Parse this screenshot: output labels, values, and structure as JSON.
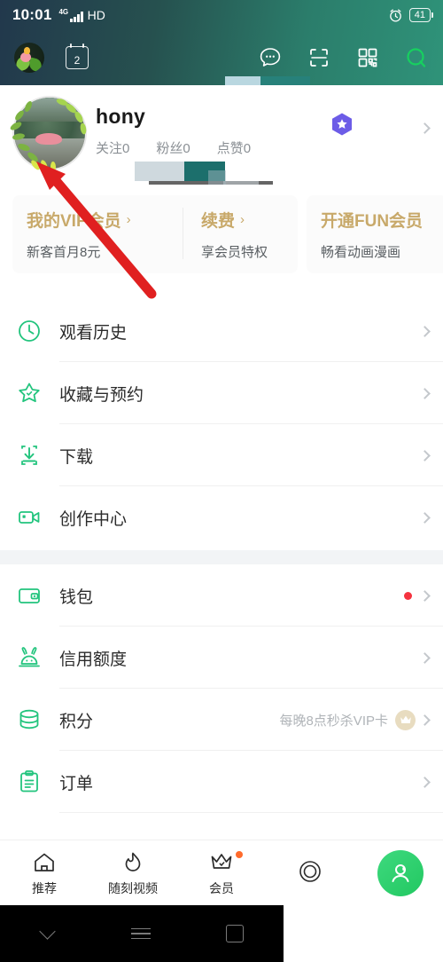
{
  "status_bar": {
    "time": "10:01",
    "network": "4G",
    "hd": "HD",
    "battery": "41",
    "alarm_icon": "alarm-clock-icon"
  },
  "app_bar": {
    "avatar_icon": "user-avatar-icon",
    "calendar_day": "2",
    "icons": [
      "message-icon",
      "scan-icon",
      "qrcode-icon",
      "search-icon"
    ]
  },
  "profile": {
    "name": "hony",
    "stats": [
      {
        "label": "关注",
        "value": "0"
      },
      {
        "label": "粉丝",
        "value": "0"
      },
      {
        "label": "点赞",
        "value": "0"
      }
    ],
    "badge_icon": "vip-star-badge-icon",
    "chevron_icon": "chevron-right-icon"
  },
  "vip_cards": [
    {
      "title": "我的VIP会员",
      "chevron": "›",
      "subtitle": "新客首月8元"
    },
    {
      "title": "续费",
      "chevron": "›",
      "subtitle": "享会员特权"
    },
    {
      "title": "开通FUN会员",
      "chevron": "",
      "subtitle": "畅看动画漫画"
    }
  ],
  "menu_group_1": [
    {
      "label": "观看历史",
      "icon": "clock-icon",
      "note": "",
      "dot": false
    },
    {
      "label": "收藏与预约",
      "icon": "star-icon",
      "note": "",
      "dot": false
    },
    {
      "label": "下载",
      "icon": "download-icon",
      "note": "",
      "dot": false
    },
    {
      "label": "创作中心",
      "icon": "video-camera-icon",
      "note": "",
      "dot": false
    }
  ],
  "menu_group_2": [
    {
      "label": "钱包",
      "icon": "wallet-icon",
      "note": "",
      "dot": true
    },
    {
      "label": "信用额度",
      "icon": "rabbit-icon",
      "note": "",
      "dot": false
    },
    {
      "label": "积分",
      "icon": "coins-icon",
      "note": "每晚8点秒杀VIP卡",
      "dot": false,
      "badge": "crown-badge-icon"
    },
    {
      "label": "订单",
      "icon": "clipboard-icon",
      "note": "",
      "dot": false
    }
  ],
  "tab_bar": {
    "tabs": [
      {
        "label": "推荐",
        "icon": "home-icon",
        "dot": false
      },
      {
        "label": "随刻视频",
        "icon": "flame-icon",
        "dot": false
      },
      {
        "label": "会员",
        "icon": "crown-icon",
        "dot": true
      },
      {
        "label": "",
        "icon": "circle-target-icon",
        "dot": false
      }
    ],
    "fab_icon": "person-leaf-icon"
  },
  "android_nav": {
    "back_icon": "chevron-down-icon",
    "menu_icon": "hamburger-icon",
    "home_icon": "square-icon"
  },
  "annotation": {
    "arrow_icon": "red-arrow-icon",
    "color": "#e02020"
  },
  "colors": {
    "header_start": "#22384c",
    "header_end": "#2f9379",
    "accent_green": "#22c861",
    "gold": "#c8a96a",
    "red_dot": "#f5333f",
    "orange_dot": "#ff6b2c"
  }
}
